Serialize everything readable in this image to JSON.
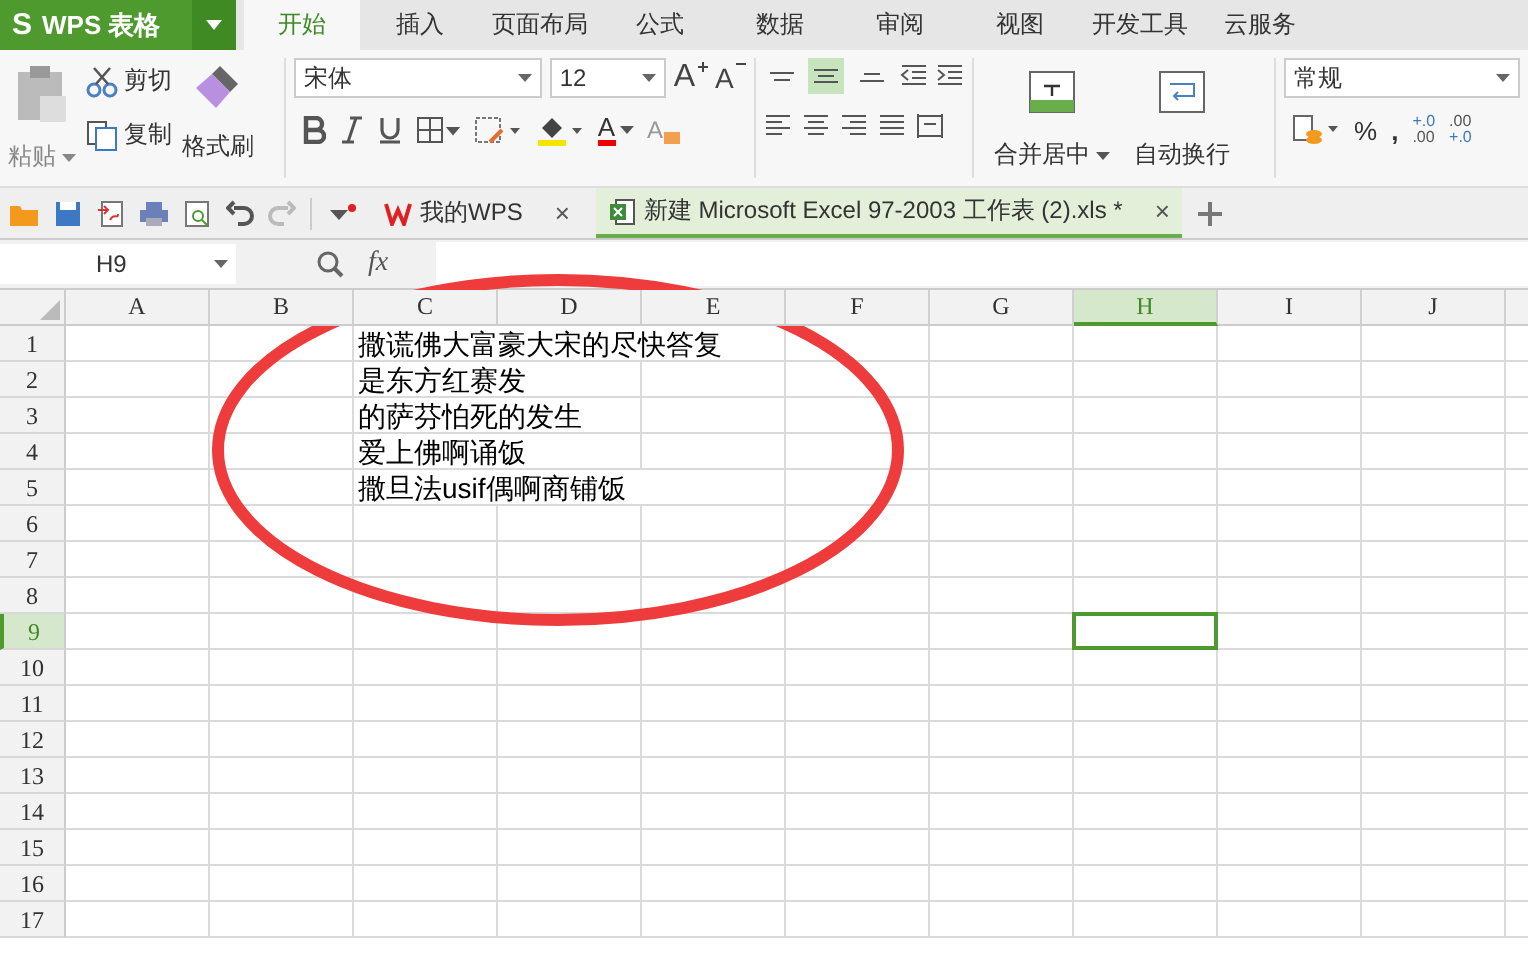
{
  "app_menu": {
    "logo": "S",
    "label": "WPS 表格"
  },
  "menu_tabs": [
    {
      "label": "开始",
      "selected": true
    },
    {
      "label": "插入",
      "selected": false
    },
    {
      "label": "页面布局",
      "selected": false
    },
    {
      "label": "公式",
      "selected": false
    },
    {
      "label": "数据",
      "selected": false
    },
    {
      "label": "审阅",
      "selected": false
    },
    {
      "label": "视图",
      "selected": false
    },
    {
      "label": "开发工具",
      "selected": false
    },
    {
      "label": "云服务",
      "selected": false
    }
  ],
  "clipboard": {
    "paste": "粘贴",
    "cut": "剪切",
    "copy": "复制",
    "format_painter": "格式刷"
  },
  "font": {
    "name": "宋体",
    "size": "12",
    "grow": "A",
    "shrink": "A",
    "color_label": "A",
    "clear": "A"
  },
  "align_buttons": [
    {
      "kind": "top",
      "selected": false
    },
    {
      "kind": "middle",
      "selected": true
    },
    {
      "kind": "bottom",
      "selected": false
    }
  ],
  "merge": {
    "merge_center": "合并居中",
    "wrap": "自动换行"
  },
  "number": {
    "format": "常规",
    "percent": "%",
    "comma": ",",
    "increase_decimal": [
      "+.0",
      ".00"
    ],
    "decrease_decimal": [
      ".00",
      "+.0"
    ]
  },
  "doc_tabs": [
    {
      "kind": "home",
      "label": "我的WPS",
      "close": "×",
      "selected": false
    },
    {
      "kind": "sheet",
      "label": "新建 Microsoft Excel 97-2003 工作表 (2).xls *",
      "close": "×",
      "selected": true
    }
  ],
  "formula_bar": {
    "name_box": "H9",
    "fx": "fx"
  },
  "columns": [
    {
      "label": "A",
      "selected": false
    },
    {
      "label": "B",
      "selected": false
    },
    {
      "label": "C",
      "selected": false
    },
    {
      "label": "D",
      "selected": false
    },
    {
      "label": "E",
      "selected": false
    },
    {
      "label": "F",
      "selected": false
    },
    {
      "label": "G",
      "selected": false
    },
    {
      "label": "H",
      "selected": true
    },
    {
      "label": "I",
      "selected": false
    },
    {
      "label": "J",
      "selected": false
    }
  ],
  "rows": [
    {
      "label": "1",
      "selected": false,
      "cells": {
        "C": "撒谎佛大富豪大宋的尽快答复"
      }
    },
    {
      "label": "2",
      "selected": false,
      "cells": {
        "C": "是东方红赛发"
      }
    },
    {
      "label": "3",
      "selected": false,
      "cells": {
        "C": "的萨芬怕死的发生"
      }
    },
    {
      "label": "4",
      "selected": false,
      "cells": {
        "C": "爱上佛啊诵饭"
      }
    },
    {
      "label": "5",
      "selected": false,
      "cells": {
        "C": "撒旦法usif偶啊商铺饭"
      }
    },
    {
      "label": "6",
      "selected": false
    },
    {
      "label": "7",
      "selected": false
    },
    {
      "label": "8",
      "selected": false
    },
    {
      "label": "9",
      "selected": true
    },
    {
      "label": "10",
      "selected": false
    },
    {
      "label": "11",
      "selected": false
    },
    {
      "label": "12",
      "selected": false
    },
    {
      "label": "13",
      "selected": false
    },
    {
      "label": "14",
      "selected": false
    },
    {
      "label": "15",
      "selected": false
    },
    {
      "label": "16",
      "selected": false
    },
    {
      "label": "17",
      "selected": false
    }
  ]
}
